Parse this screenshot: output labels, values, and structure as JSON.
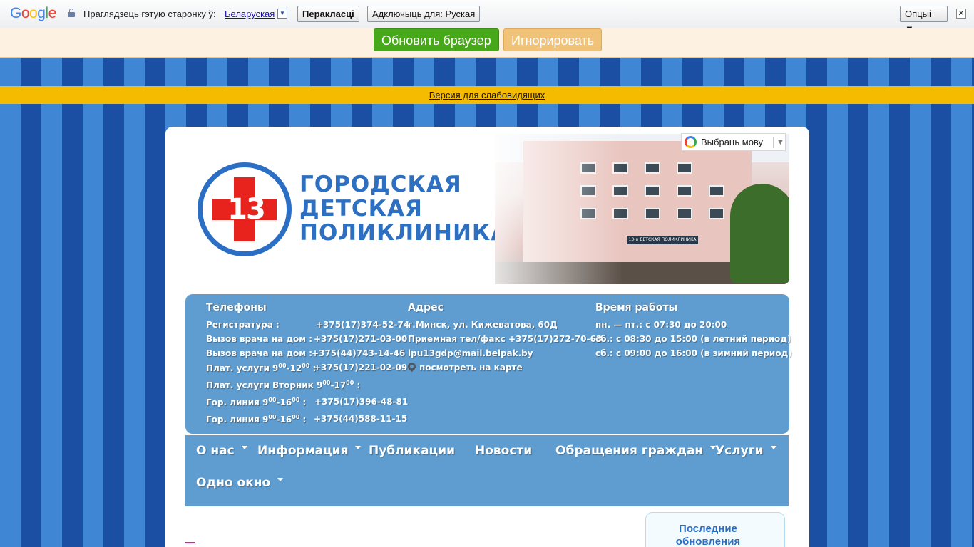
{
  "translate_bar": {
    "logo": "Google",
    "prompt": "Праглядзець гэтую старонку ў:",
    "language": "Беларуская",
    "translate_button": "Перакласці",
    "disable_button": "Адключыць для: Руская",
    "options_button": "Опцыі ▼",
    "close": "✕"
  },
  "update_bar": {
    "refresh_button": "Обновить браузер",
    "ignore_button": "Игнорировать"
  },
  "accessibility_link": "Версия для слабовидящих",
  "header": {
    "logo_number": "13",
    "logo_lines": [
      "ГОРОДСКАЯ",
      "ДЕТСКАЯ",
      "ПОЛИКЛИНИКА"
    ],
    "building_sign": "13-я ДЕТСКАЯ ПОЛИКЛИНИКА",
    "language_selector": "Выбраць мову",
    "language_selector_arrow": "▼"
  },
  "contacts": {
    "phones_title": "Телефоны",
    "registry_label": "Регистратура :",
    "registry_phone": "+375(17)374-52-74",
    "home_call_label": "Вызов врача на дом :",
    "home_call_phone_1": "+375(17)271-03-00",
    "home_call_phone_2": "+375(44)743-14-46",
    "paid_label_a": "Плат. услуги 9",
    "paid_sup_a": "00",
    "paid_label_b": "-12",
    "paid_sup_b": "00",
    "paid_label_c": " :",
    "paid_phone": "+375(17)221-02-09",
    "paid_tue_a": "Плат. услуги Вторник 9",
    "paid_tue_sup_a": "00",
    "paid_tue_b": "-17",
    "paid_tue_sup_b": "00",
    "paid_tue_c": " :",
    "line_a": "Гор. линия 9",
    "line_sup_a": "00",
    "line_b": "-16",
    "line_sup_b": "00",
    "line_c": " :",
    "line_phone_1": "+375(17)396-48-81",
    "line_phone_2": "+375(44)588-11-15",
    "address_title": "Адрес",
    "address": "г.Минск, ул. Кижеватова, 60Д",
    "reception": "Приемная тел/факс +375(17)272-70-63",
    "email": "lpu13gdp@mail.belpak.by",
    "map_link": "посмотреть на карте",
    "hours_title": "Время работы",
    "hours_weekdays": "пн. — пт.: с 07:30 до 20:00",
    "hours_sat_summer": "сб.: с 08:30 до 15:00 (в летний период)",
    "hours_sat_winter": "сб.: с 09:00 до 16:00 (в зимний период)"
  },
  "nav": {
    "about": "О нас",
    "info": "Информация",
    "publications": "Публикации",
    "news": "Новости",
    "appeals": "Обращения граждан",
    "services": "Услуги",
    "one_window": "Одно окно"
  },
  "sidebar": {
    "updates_title": "Последние обновления"
  },
  "colors": {
    "stripe_light": "#3f86d4",
    "stripe_dark": "#1a4fa3",
    "panel_blue": "#5f9dd0",
    "accessibility_yellow": "#f5bb00",
    "refresh_green": "#47a91a",
    "ignore_orange": "#f1c379",
    "logo_red": "#e8221c",
    "logo_blue": "#2d6fc0"
  }
}
